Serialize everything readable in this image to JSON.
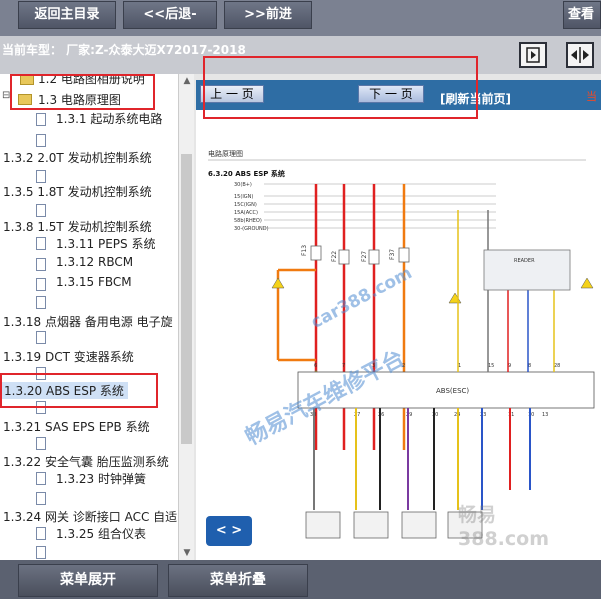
{
  "toolbar": {
    "back_main": "返回主目录",
    "back": "<<后退-",
    "forward": ">>前进",
    "view": "查看"
  },
  "car": {
    "label": "当前车型：  厂家:Z-众泰大迈X72017-2018"
  },
  "tree": {
    "items": [
      {
        "label": "1.2  电路图相册说明"
      },
      {
        "label": "1.3 电路原理图"
      },
      {
        "label": "1.3.1 起动系统电路"
      },
      {
        "label": "1.3.2 2.0T 发动机控制系统"
      },
      {
        "label": "1.3.5 1.8T 发动机控制系统"
      },
      {
        "label": "1.3.8 1.5T 发动机控制系统"
      },
      {
        "label": "1.3.11 PEPS 系统"
      },
      {
        "label": "1.3.12 RBCM"
      },
      {
        "label": "1.3.15 FBCM"
      },
      {
        "label": "1.3.18 点烟器 备用电源 电子旋"
      },
      {
        "label": "1.3.19 DCT 变速器系统"
      },
      {
        "label": "1.3.20 ABS ESP 系统"
      },
      {
        "label": "1.3.21 SAS EPS EPB 系统"
      },
      {
        "label": "1.3.22 安全气囊 胎压监测系统"
      },
      {
        "label": "1.3.23 时钟弹簧"
      },
      {
        "label": "1.3.24 网关 诊断接口 ACC 自适"
      },
      {
        "label": "1.3.25 组合仪表"
      }
    ]
  },
  "viewer": {
    "prev": "上 一 页",
    "next": "下 一 页",
    "refresh": "[刷新当前页]",
    "note": "当",
    "nav": "< >",
    "diagram_header": "电路原理图",
    "diagram_title": "6.3.20 ABS ESP 系统",
    "fuses": [
      "F13",
      "F22",
      "F27",
      "F37"
    ],
    "pin_top": [
      "6",
      "7",
      "3",
      "2",
      "1",
      "15",
      "9",
      "8",
      "28"
    ],
    "pin_bottom": [
      "30",
      "27",
      "26",
      "29",
      "30",
      "24",
      "23",
      "11",
      "10",
      "13"
    ],
    "buses": [
      "30(B+)",
      "15(IGN)",
      "15C(IGN)",
      "15A(ACC)",
      "58b(RHEO)",
      "30-(GROUND)"
    ],
    "module": "ABS(ESC)",
    "right_module": "READER",
    "watermarks": [
      "car388.com",
      "畅易汽车维修平台",
      "畅易",
      "388.com"
    ]
  },
  "bottom": {
    "expand": "菜单展开",
    "collapse": "菜单折叠"
  }
}
